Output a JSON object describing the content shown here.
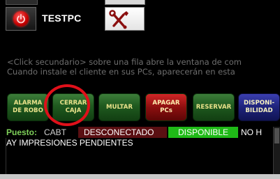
{
  "pc_table": {
    "rows": [
      {
        "name": "TESTPC",
        "power_icon": "power-icon",
        "tools_icon": "tools-icon"
      }
    ]
  },
  "hints": {
    "line1": "<Click secundario> sobre una fila abre la ventana de com",
    "line2": "Cuando instale el cliente en sus PCs, aparecerán en esta"
  },
  "actions": [
    {
      "lines": [
        "ALARMA",
        "DE ROBO"
      ],
      "style": "green"
    },
    {
      "lines": [
        "CERRAR",
        "CAJA"
      ],
      "style": "green"
    },
    {
      "lines": [
        "MULTAR"
      ],
      "style": "green"
    },
    {
      "lines": [
        "APAGAR",
        "PCs"
      ],
      "style": "red"
    },
    {
      "lines": [
        "RESERVAR"
      ],
      "style": "green"
    },
    {
      "lines": [
        "DISPONI-",
        "BILIDAD"
      ],
      "style": "blue"
    }
  ],
  "status": {
    "label": "Puesto:",
    "pc": "CABT",
    "connection": "DESCONECTADO",
    "availability": "DISPONIBLE",
    "truncated": "NO H"
  },
  "log": {
    "line": "AY IMPRESIONES PENDIENTES"
  },
  "colors": {
    "button_green": "#1f5a1f",
    "button_red": "#8c0f0f",
    "button_blue": "#1e237a",
    "status_disconnected_bg": "#5a0f12",
    "status_available_bg": "#1fba17",
    "highlight_circle": "#e0101a"
  }
}
